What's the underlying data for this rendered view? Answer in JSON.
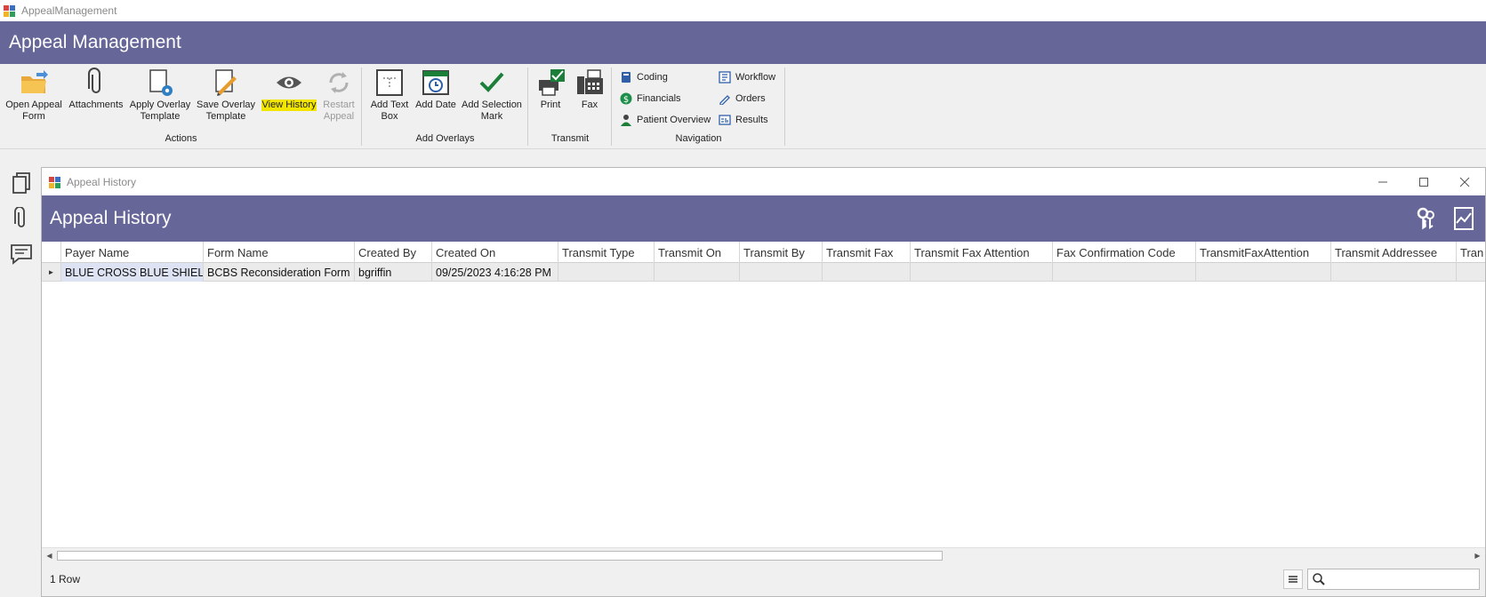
{
  "window": {
    "title": "AppealManagement"
  },
  "app": {
    "title": "Appeal Management"
  },
  "ribbon": {
    "actions": {
      "label": "Actions",
      "open_appeal_form": [
        "Open Appeal",
        "Form"
      ],
      "attachments": [
        "Attachments",
        ""
      ],
      "apply_overlay_template": [
        "Apply Overlay",
        "Template"
      ],
      "save_overlay_template": [
        "Save Overlay",
        "Template"
      ],
      "view_history": [
        "View History",
        ""
      ],
      "restart_appeal": [
        "Restart",
        "Appeal"
      ]
    },
    "overlays": {
      "label": "Add Overlays",
      "add_text_box": [
        "Add Text",
        "Box"
      ],
      "add_date": [
        "Add Date",
        ""
      ],
      "add_selection_mark": [
        "Add Selection",
        "Mark"
      ]
    },
    "transmit": {
      "label": "Transmit",
      "print": [
        "Print",
        ""
      ],
      "fax": [
        "Fax",
        ""
      ]
    },
    "navigation": {
      "label": "Navigation",
      "coding": "Coding",
      "financials": "Financials",
      "patient_overview": "Patient Overview",
      "workflow": "Workflow",
      "orders": "Orders",
      "results": "Results"
    }
  },
  "history_window": {
    "title": "Appeal History",
    "header": "Appeal History",
    "columns": [
      "Payer Name",
      "Form Name",
      "Created By",
      "Created On",
      "Transmit Type",
      "Transmit On",
      "Transmit By",
      "Transmit Fax",
      "Transmit Fax Attention",
      "Fax Confirmation Code",
      "TransmitFaxAttention",
      "Transmit Addressee",
      "Tran"
    ],
    "rows": [
      [
        "BLUE CROSS BLUE SHIELD",
        "BCBS Reconsideration Form",
        "bgriffin",
        "09/25/2023 4:16:28 PM",
        "",
        "",
        "",
        "",
        "",
        "",
        "",
        "",
        ""
      ]
    ],
    "status": "1 Row",
    "search": {
      "placeholder": ""
    }
  },
  "colors": {
    "header_band": "#666699",
    "highlight": "#f2e600",
    "check_green": "#1b7f3a"
  }
}
